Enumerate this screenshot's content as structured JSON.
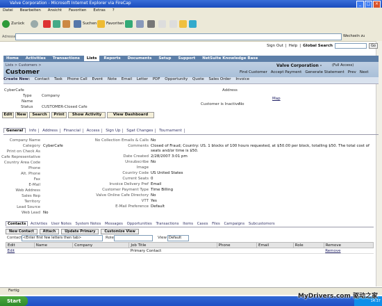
{
  "window": {
    "title": "Valve Corporation - Microsoft Internet Explorer via FireCap"
  },
  "menu": [
    "Datei",
    "Bearbeiten",
    "Ansicht",
    "Favoriten",
    "Extras",
    "?"
  ],
  "toolbar": {
    "back": "Zurück",
    "search": "Suchen",
    "favorites": "Favoriten"
  },
  "address": {
    "label": "Adresse",
    "go": "Wechseln zu"
  },
  "top_links": {
    "signout": "Sign Out",
    "help": "Help",
    "global_search": "Global Search",
    "go": "Go"
  },
  "nav_tabs": [
    "Home",
    "Activities",
    "Transactions",
    "Lists",
    "Reports",
    "Documents",
    "Setup",
    "Support",
    "NetSuite Knowledge Base"
  ],
  "breadcrumb": "Lists > Customers >",
  "page_title": "Customer",
  "company": "Valve Corporation -",
  "access": "(Full Access)",
  "header_actions": [
    "Find Customer",
    "Accept Payment",
    "Generate Statement",
    "Prev",
    "Next"
  ],
  "create_new": {
    "label": "Create New:",
    "items": [
      "Contact",
      "Task",
      "Phone Call",
      "Event",
      "Note",
      "Email",
      "Letter",
      "PDF",
      "Opportunity",
      "Quote",
      "Sales Order",
      "Invoice"
    ]
  },
  "customer": {
    "name_value": "CyberCafe",
    "type_label": "Type",
    "type_value": "Company",
    "name_label": "Name",
    "status_label": "Status",
    "status_value": "CUSTOMER-Closed Cafe",
    "address_label": "Address",
    "map": "Map",
    "inactive_label": "Customer is Inactive",
    "inactive_value": "No"
  },
  "action_buttons": [
    "Edit",
    "New",
    "Search",
    "Print",
    "Show Activity",
    "View Dashboard"
  ],
  "sub_tabs": [
    "General",
    "Info",
    "Address",
    "Financial",
    "Access",
    "Sign Up",
    "Sgat Changes",
    "Tournament"
  ],
  "left_fields": [
    {
      "k": "Company Name",
      "v": ""
    },
    {
      "k": "Category",
      "v": "CyberCafe"
    },
    {
      "k": "Print on Check As",
      "v": ""
    },
    {
      "k": "Cafe Representative",
      "v": ""
    },
    {
      "k": "Country Area Code",
      "v": ""
    },
    {
      "k": "Phone",
      "v": ""
    },
    {
      "k": "Alt. Phone",
      "v": ""
    },
    {
      "k": "Fax",
      "v": ""
    },
    {
      "k": "E-Mail",
      "v": ""
    },
    {
      "k": "Web Address",
      "v": ""
    },
    {
      "k": "Sales Rep",
      "v": ""
    },
    {
      "k": "Territory",
      "v": ""
    },
    {
      "k": "Lead Source",
      "v": ""
    },
    {
      "k": "Web Lead",
      "v": "No"
    }
  ],
  "right_fields": [
    {
      "k": "No Collection Emails & Calls",
      "v": "No"
    },
    {
      "k": "Comments",
      "v": "Closed of Fraud; Country: US. 1 blocks of 100 hours requested, at $50.00 per block, totalling $50. The total cost of seats and/or time is $50."
    },
    {
      "k": "Date Created",
      "v": "2/28/2007 3:01 pm"
    },
    {
      "k": "Unsubscribe",
      "v": "No"
    },
    {
      "k": "Image",
      "v": ""
    },
    {
      "k": "Country Code",
      "v": "US United States"
    },
    {
      "k": "Current Seats",
      "v": "0"
    },
    {
      "k": "Invoice Delivery Pref",
      "v": "Email"
    },
    {
      "k": "Customer Payment Type",
      "v": "Time Billing"
    },
    {
      "k": "Valve Online Cafe Directory",
      "v": "No"
    },
    {
      "k": "VTT",
      "v": "Yes"
    },
    {
      "k": "E-Mail Preference",
      "v": "Default"
    }
  ],
  "bottom_tabs": [
    "Contacts",
    "Activities",
    "User Notes",
    "System Notes",
    "Messages",
    "Opportunities",
    "Transactions",
    "Items",
    "Cases",
    "Files",
    "Campaigns",
    "Subcustomers"
  ],
  "contact_buttons": [
    "New Contact",
    "Attach",
    "Update Primary",
    "Customize View"
  ],
  "contact_filter": {
    "contact_label": "Contact",
    "contact_value": "<Enter first few letters then tab>",
    "role_label": "Role",
    "view_label": "View",
    "view_value": "Default"
  },
  "contacts_table": {
    "headers": [
      "Edit",
      "Name",
      "Company",
      "Job Title",
      "Phone",
      "Email",
      "Role",
      "Remove"
    ],
    "rows": [
      [
        "Edit",
        "",
        "",
        "Primary Contact",
        "",
        "",
        "",
        "Remove"
      ]
    ]
  },
  "status": {
    "text": "Fertig"
  },
  "taskbar": {
    "start": "Start",
    "time": "14:37"
  },
  "watermark": "MyDrivers.com 驱动之家"
}
